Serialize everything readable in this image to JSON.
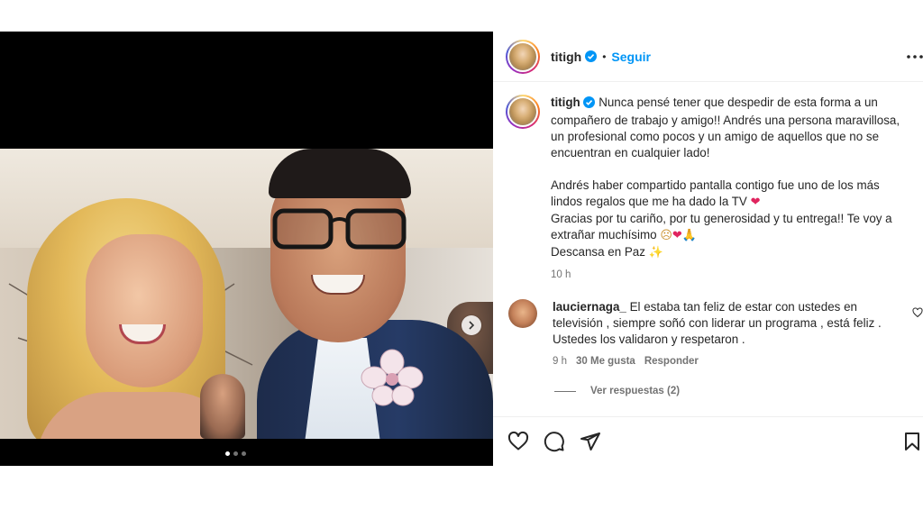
{
  "post": {
    "username": "titigh",
    "follow_label": "Seguir",
    "separator": "•",
    "carousel": {
      "active_index": 0,
      "count": 3
    }
  },
  "caption": {
    "username": "titigh",
    "line1": "Nunca pensé tener que despedir de esta forma a un compañero de trabajo y amigo!! Andrés una persona maravillosa, un profesional como pocos y un amigo de aquellos que no se encuentran en cualquier lado!",
    "line2": "Andrés haber compartido pantalla contigo fue uno de los más lindos regalos que me ha dado la TV",
    "line3": "Gracias por tu cariño, por tu generosidad y tu entrega!! Te voy a extrañar muchísimo",
    "line4": "Descansa en Paz",
    "emoji_heart": "❤",
    "emoji_sad": "☹",
    "emoji_pray": "🙏",
    "emoji_sparkle": "✨",
    "time": "10 h"
  },
  "comments": [
    {
      "username": "lauciernaga_",
      "text": "El estaba tan feliz de estar con ustedes en televisión , siempre soñó con liderar un programa , está feliz . Ustedes los validaron y respetaron .",
      "time": "9 h",
      "likes": "30 Me gusta",
      "reply_label": "Responder"
    }
  ],
  "replies_label": "Ver respuestas (2)",
  "icons": {
    "like": "heart-icon",
    "comment": "comment-icon",
    "share": "send-icon",
    "save": "bookmark-icon",
    "more": "more-options-icon",
    "verified": "verified-badge-icon",
    "next": "chevron-right-icon"
  },
  "colors": {
    "link_blue": "#0095f6",
    "verified_blue": "#0095f6",
    "secondary_text": "#737373",
    "heart_red": "#e0245e"
  }
}
